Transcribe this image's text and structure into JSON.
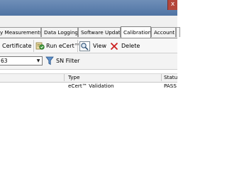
{
  "window": {
    "close_glyph": "x"
  },
  "tabs": [
    {
      "label": "y Measurements",
      "active": false
    },
    {
      "label": "Data Logging",
      "active": false
    },
    {
      "label": "Software Update",
      "active": false
    },
    {
      "label": "Calibration",
      "active": true
    },
    {
      "label": "Account",
      "active": false
    }
  ],
  "toolbar": {
    "certificate_label": "Certificate",
    "run_ecert_label": "Run eCert™",
    "view_label": "View",
    "delete_label": "Delete"
  },
  "filter": {
    "device_value": "63",
    "sn_filter_label": "SN Filter"
  },
  "table": {
    "columns": [
      "Type",
      "Status"
    ],
    "column_header_visible": [
      "Type",
      "Statu"
    ],
    "rows": [
      {
        "type": "eCert™ Validation",
        "status": "PASS"
      }
    ]
  },
  "icons": {
    "run_ecert": "run-ecert-icon",
    "view": "magnifier-icon",
    "delete": "delete-x-icon",
    "filter": "funnel-icon"
  },
  "colors": {
    "titlebar": "#5b7dab",
    "delete_red": "#cc1f1f"
  }
}
